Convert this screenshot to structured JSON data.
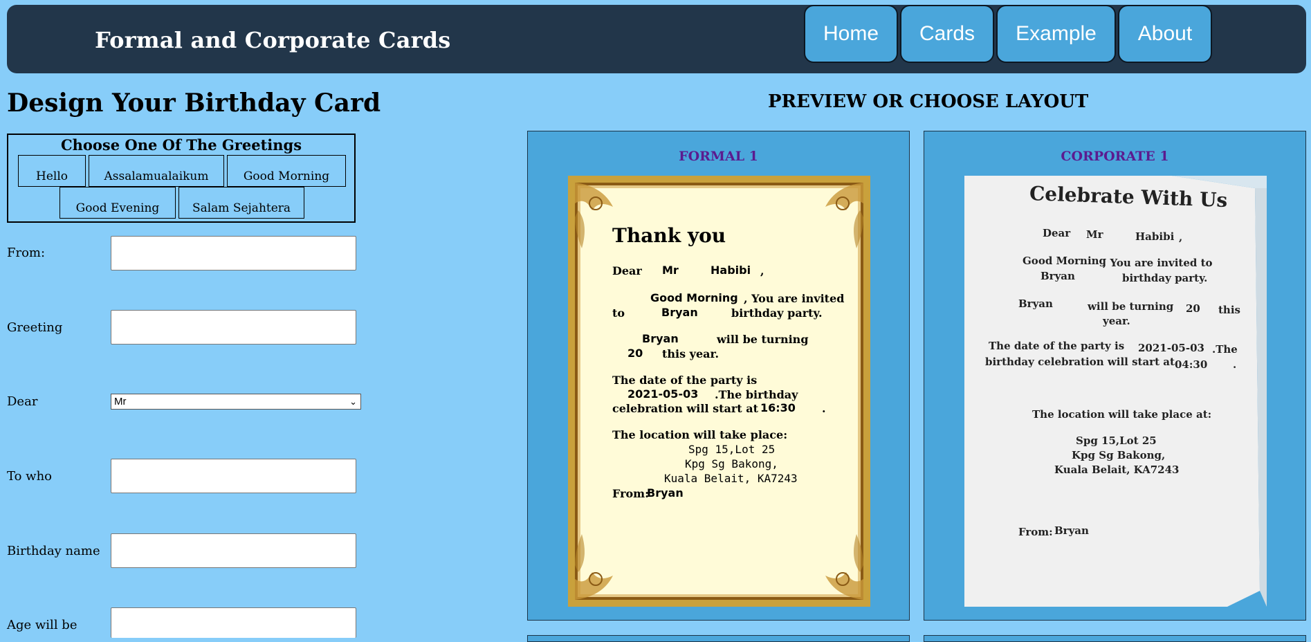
{
  "header": {
    "title": "Formal and Corporate Cards",
    "nav": [
      {
        "label": "Home"
      },
      {
        "label": "Cards"
      },
      {
        "label": "Example"
      },
      {
        "label": "About"
      }
    ]
  },
  "form": {
    "title": "Design Your Birthday Card",
    "greetings_title": "Choose One Of The Greetings",
    "greetings": [
      "Hello",
      "Assalamualaikum",
      "Good Morning",
      "Good Evening",
      "Salam Sejahtera"
    ],
    "fields": {
      "from": {
        "label": "From:",
        "value": ""
      },
      "greeting": {
        "label": "Greeting",
        "value": ""
      },
      "dear": {
        "label": "Dear",
        "selected": "Mr"
      },
      "to_who": {
        "label": "To who",
        "value": ""
      },
      "birthday_name": {
        "label": "Birthday name",
        "value": ""
      },
      "age": {
        "label": "Age will be",
        "value": ""
      }
    }
  },
  "preview": {
    "heading": "PREVIEW OR CHOOSE LAYOUT",
    "formal": {
      "name": "FORMAL 1",
      "title": "Thank you",
      "dear": "Dear",
      "salutation": "Mr",
      "to_name": "Habibi",
      "comma": ",",
      "greeting": "Good Morning",
      "invited": ", You are invited",
      "to": "to",
      "birthday_name": "Bryan",
      "party": "birthday party.",
      "name2": "Bryan",
      "turning": "will be turning",
      "age": "20",
      "this_year": "this year.",
      "date_intro": "The date of the party is",
      "date": "2021-05-03",
      "birthday_after": ".The birthday",
      "celebration": "celebration will start at",
      "time": "16:30",
      "period": ".",
      "location_intro": "The location will take place:",
      "address": [
        "Spg 15,Lot 25",
        "Kpg Sg Bakong,",
        "Kuala Belait, KA7243"
      ],
      "from_label": "From:",
      "from_name": "Bryan"
    },
    "corporate": {
      "name": "CORPORATE 1",
      "title": "Celebrate With Us",
      "dear": "Dear",
      "salutation": "Mr",
      "to_name": "Habibi",
      "comma": ",",
      "greeting": "Good Morning",
      "invited": ", You are invited to",
      "birthday_name": "Bryan",
      "party": "birthday party.",
      "name2": "Bryan",
      "turning": "will be turning",
      "age": "20",
      "this": "this",
      "year": "year.",
      "date_intro": "The date of the party is",
      "date": "2021-05-03",
      "the": ".The",
      "celebration": "birthday celebration will start at",
      "time": "04:30",
      "period": ".",
      "location_intro": "The location will take place at:",
      "address": [
        "Spg 15,Lot 25",
        "Kpg Sg Bakong,",
        "Kuala Belait, KA7243"
      ],
      "from_label": "From:",
      "from_name": "Bryan"
    }
  }
}
